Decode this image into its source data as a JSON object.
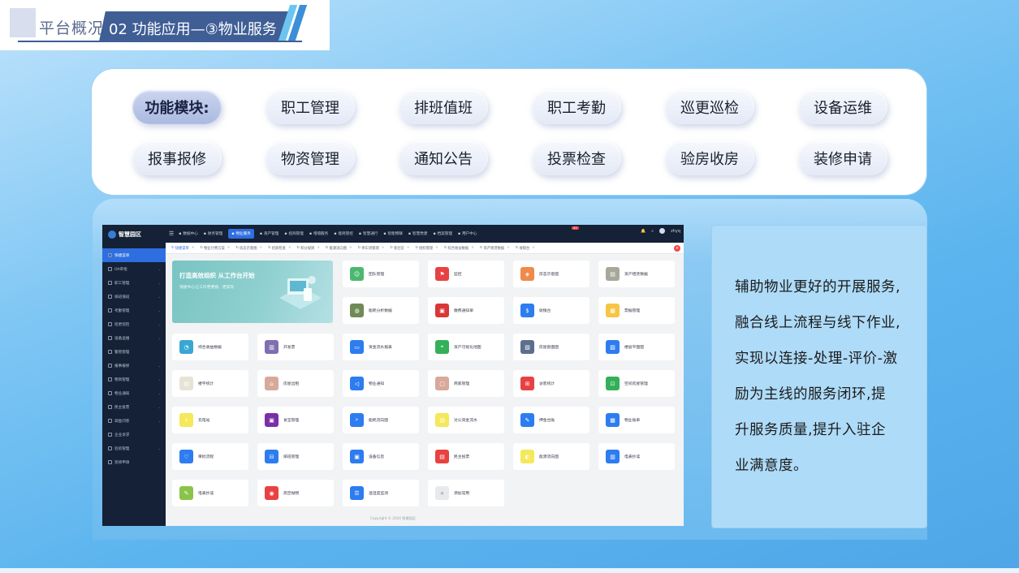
{
  "header": {
    "section": "平台概况",
    "title": "02 功能应用—③物业服务"
  },
  "modules": {
    "lead": "功能模块:",
    "items": [
      "职工管理",
      "排班值班",
      "职工考勤",
      "巡更巡检",
      "设备运维",
      "报事报修",
      "物资管理",
      "通知公告",
      "投票检查",
      "验房收房",
      "装修申请"
    ]
  },
  "description": {
    "lines": [
      "辅助物业更好的开展服务,",
      "融合线上流程与线下作业,",
      "实现以连接-处理-评价-激",
      "励为主线的服务闭环,提",
      "升服务质量,提升入驻企",
      "业满意度。"
    ]
  },
  "app": {
    "logo": "智慧园区",
    "sidebar": [
      "快捷菜单",
      "OA审批",
      "职工管理",
      "排班值班",
      "考勤管理",
      "巡更巡检",
      "设备运维",
      "警管管理",
      "报事报修",
      "物资管理",
      "物业通知",
      "民主投票",
      "调查问卷",
      "企业诉求",
      "验房管理",
      "装修申请"
    ],
    "topnav": [
      "数据中心",
      "财务管理",
      "物业服务",
      "资产管理",
      "招商管理",
      "增值服务",
      "能耗管控",
      "智慧通行",
      "智能物联",
      "智慧党建",
      "档案管理",
      "用户中心"
    ],
    "notif_count": "37",
    "user": "zhyq",
    "tabs": [
      "快捷菜单",
      "物业计费方案",
      "房态示意图",
      "招商检查",
      "积分规则",
      "能源流向图",
      "停车场管理",
      "客社云",
      "组织管理",
      "综合收益数据",
      "资产租赁数据",
      "收银台"
    ],
    "banner": {
      "title": "打造高效组织 从工作台开始",
      "subtitle": "快捷中心让工作更便捷、更高效"
    },
    "cards": [
      {
        "label": "团队管理",
        "color": "#4cb86f",
        "icon": "team-icon"
      },
      {
        "label": "监控",
        "color": "#e84141",
        "icon": "monitor-icon"
      },
      {
        "label": "房态示意图",
        "color": "#f08a4b",
        "icon": "tag-icon"
      },
      {
        "label": "资产租赁数据",
        "color": "#a8a89a",
        "icon": "doc-icon"
      },
      {
        "label": "能耗分析数据",
        "color": "#6f8a55",
        "icon": "globe-icon"
      },
      {
        "label": "缴费通知单",
        "color": "#d93636",
        "icon": "bill-icon"
      },
      {
        "label": "收银台",
        "color": "#2d7cf0",
        "icon": "cash-icon"
      },
      {
        "label": "票据管理",
        "color": "#f6c544",
        "icon": "ticket-icon"
      },
      {
        "label": "综合收益数据",
        "color": "#3aa6d3",
        "icon": "pie-icon"
      },
      {
        "label": "开发票",
        "color": "#7f6eb0",
        "icon": "invoice-icon"
      },
      {
        "label": "资金流水报表",
        "color": "#2d7cf0",
        "icon": "report-icon"
      },
      {
        "label": "资产可视化地图",
        "color": "#34b05a",
        "icon": "map-icon"
      },
      {
        "label": "房屋剖面图",
        "color": "#5d6f8e",
        "icon": "section-icon"
      },
      {
        "label": "楼层平面图",
        "color": "#2d7cf0",
        "icon": "floor-icon"
      },
      {
        "label": "楼宇统计",
        "color": "#e6e3d5",
        "icon": "building-icon"
      },
      {
        "label": "房屋出租",
        "color": "#d7a99b",
        "icon": "rent-icon"
      },
      {
        "label": "物业通知",
        "color": "#2d7cf0",
        "icon": "speaker-icon"
      },
      {
        "label": "商家管理",
        "color": "#d7a99b",
        "icon": "shop-icon"
      },
      {
        "label": "访客统计",
        "color": "#e84141",
        "icon": "gift-icon"
      },
      {
        "label": "空间房屋管理",
        "color": "#34b05a",
        "icon": "lock-icon"
      },
      {
        "label": "充电站",
        "color": "#f5e85a",
        "icon": "charge-icon"
      },
      {
        "label": "食堂管理",
        "color": "#7a2fa5",
        "icon": "canteen-icon"
      },
      {
        "label": "能耗流向图",
        "color": "#2d7cf0",
        "icon": "flow-icon"
      },
      {
        "label": "对公资金流水",
        "color": "#f5e85a",
        "icon": "fund-icon"
      },
      {
        "label": "押金台账",
        "color": "#2d7cf0",
        "icon": "deposit-icon"
      },
      {
        "label": "物业账单",
        "color": "#2d7cf0",
        "icon": "statement-icon"
      },
      {
        "label": "审批流程",
        "color": "#2d7cf0",
        "icon": "heart-icon"
      },
      {
        "label": "排班管理",
        "color": "#2d7cf0",
        "icon": "schedule-icon"
      },
      {
        "label": "设备信息",
        "color": "#2d7cf0",
        "icon": "device-icon"
      },
      {
        "label": "民主投票",
        "color": "#e84141",
        "icon": "vote-icon"
      },
      {
        "label": "能源流向图",
        "color": "#f5e85a",
        "icon": "energy-icon"
      },
      {
        "label": "电表抄读",
        "color": "#2d7cf0",
        "icon": "meter-icon"
      },
      {
        "label": "电表抄读",
        "color": "#8bc34a",
        "icon": "edit-icon"
      },
      {
        "label": "高空抛物",
        "color": "#e84141",
        "icon": "eye-icon"
      },
      {
        "label": "温湿度监测",
        "color": "#2d7cf0",
        "icon": "list-icon"
      },
      {
        "label": "添加常用",
        "color": "#e8e9ec",
        "icon": "plus-icon"
      }
    ],
    "copyright": "Copyright © 2024 智慧园区"
  }
}
